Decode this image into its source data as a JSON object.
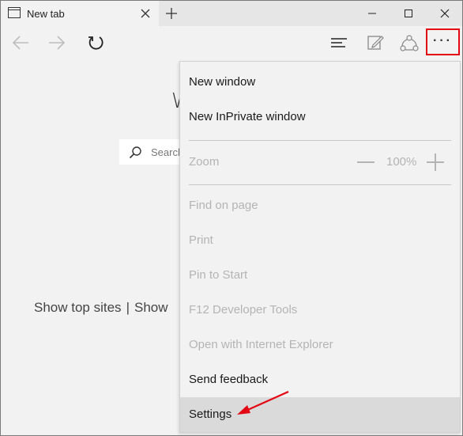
{
  "window": {
    "tab_title": "New tab",
    "tab_icon": "browser-tab-icon",
    "controls": [
      "minimize-icon",
      "maximize-icon",
      "close-icon"
    ]
  },
  "toolbar": {
    "icons": [
      "back-arrow-icon",
      "forward-arrow-icon",
      "refresh-icon",
      "hub-icon",
      "web-note-icon",
      "share-icon",
      "more-actions-icon"
    ],
    "more_label": "···",
    "highlight_color": "#e30613"
  },
  "page": {
    "heading": "W",
    "search_placeholder": "Search",
    "links_left": "Show top sites",
    "links_sep": "|",
    "links_right": "Show"
  },
  "menu": {
    "new_window": "New window",
    "new_inprivate": "New InPrivate window",
    "zoom_label": "Zoom",
    "zoom_value": "100%",
    "find": "Find on page",
    "print": "Print",
    "pin": "Pin to Start",
    "devtools": "F12 Developer Tools",
    "open_ie": "Open with Internet Explorer",
    "feedback": "Send feedback",
    "settings": "Settings"
  },
  "annotation": {
    "arrow_color": "#e30613",
    "points_to": "Settings"
  }
}
